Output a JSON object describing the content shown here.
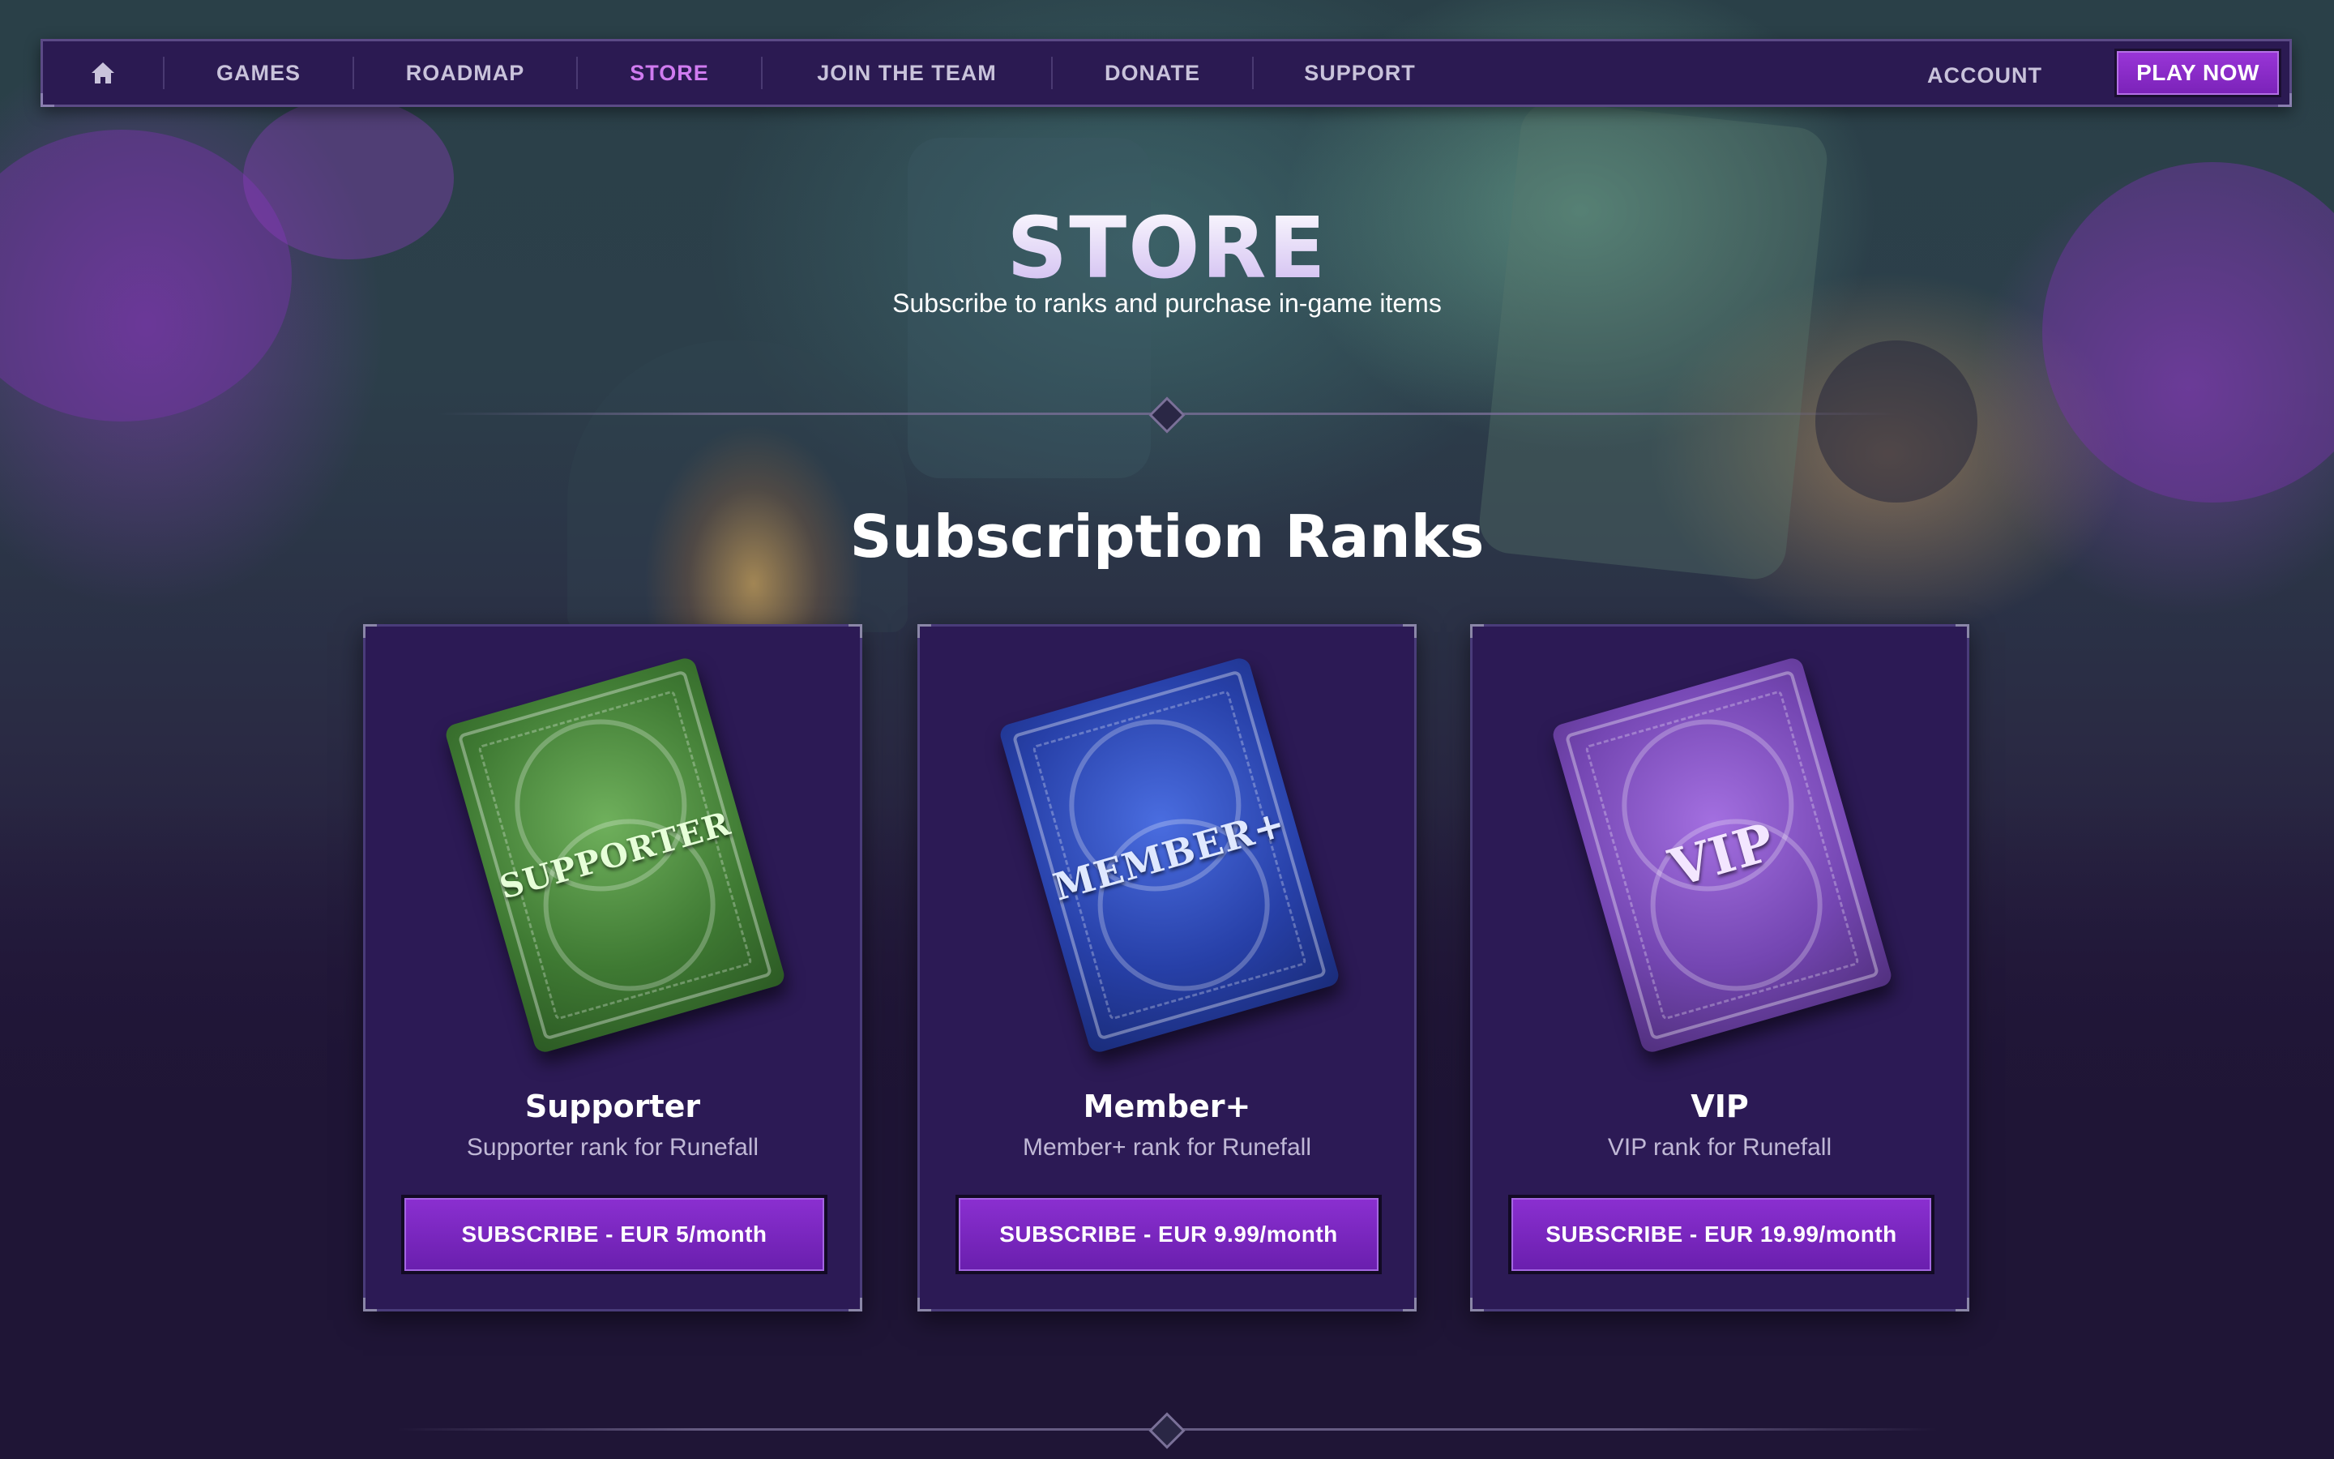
{
  "nav": {
    "home_icon": "home-icon",
    "items": [
      {
        "label": "GAMES"
      },
      {
        "label": "ROADMAP"
      },
      {
        "label": "STORE",
        "active": true
      },
      {
        "label": "JOIN THE TEAM"
      },
      {
        "label": "DONATE"
      },
      {
        "label": "SUPPORT"
      }
    ],
    "account_label": "ACCOUNT",
    "play_label": "PLAY NOW"
  },
  "hero": {
    "title": "STORE",
    "subtitle": "Subscribe to ranks and purchase in-game items"
  },
  "section": {
    "title": "Subscription Ranks"
  },
  "ranks": [
    {
      "card_art_text": "SUPPORTER",
      "name": "Supporter",
      "description": "Supporter rank for Runefall",
      "button": "SUBSCRIBE - EUR 5/month",
      "color": "#4f9a3e"
    },
    {
      "card_art_text": "MEMBER+",
      "name": "Member+",
      "description": "Member+ rank for Runefall",
      "button": "SUBSCRIBE - EUR 9.99/month",
      "color": "#2f4fc8"
    },
    {
      "card_art_text": "VIP",
      "name": "VIP",
      "description": "VIP rank for Runefall",
      "button": "SUBSCRIBE - EUR 19.99/month",
      "color": "#8a55cc"
    }
  ],
  "colors": {
    "accent": "#d07bf0",
    "button": "#7a22b8",
    "card_bg": "#2c1a55",
    "page_bg": "#1f1536"
  }
}
